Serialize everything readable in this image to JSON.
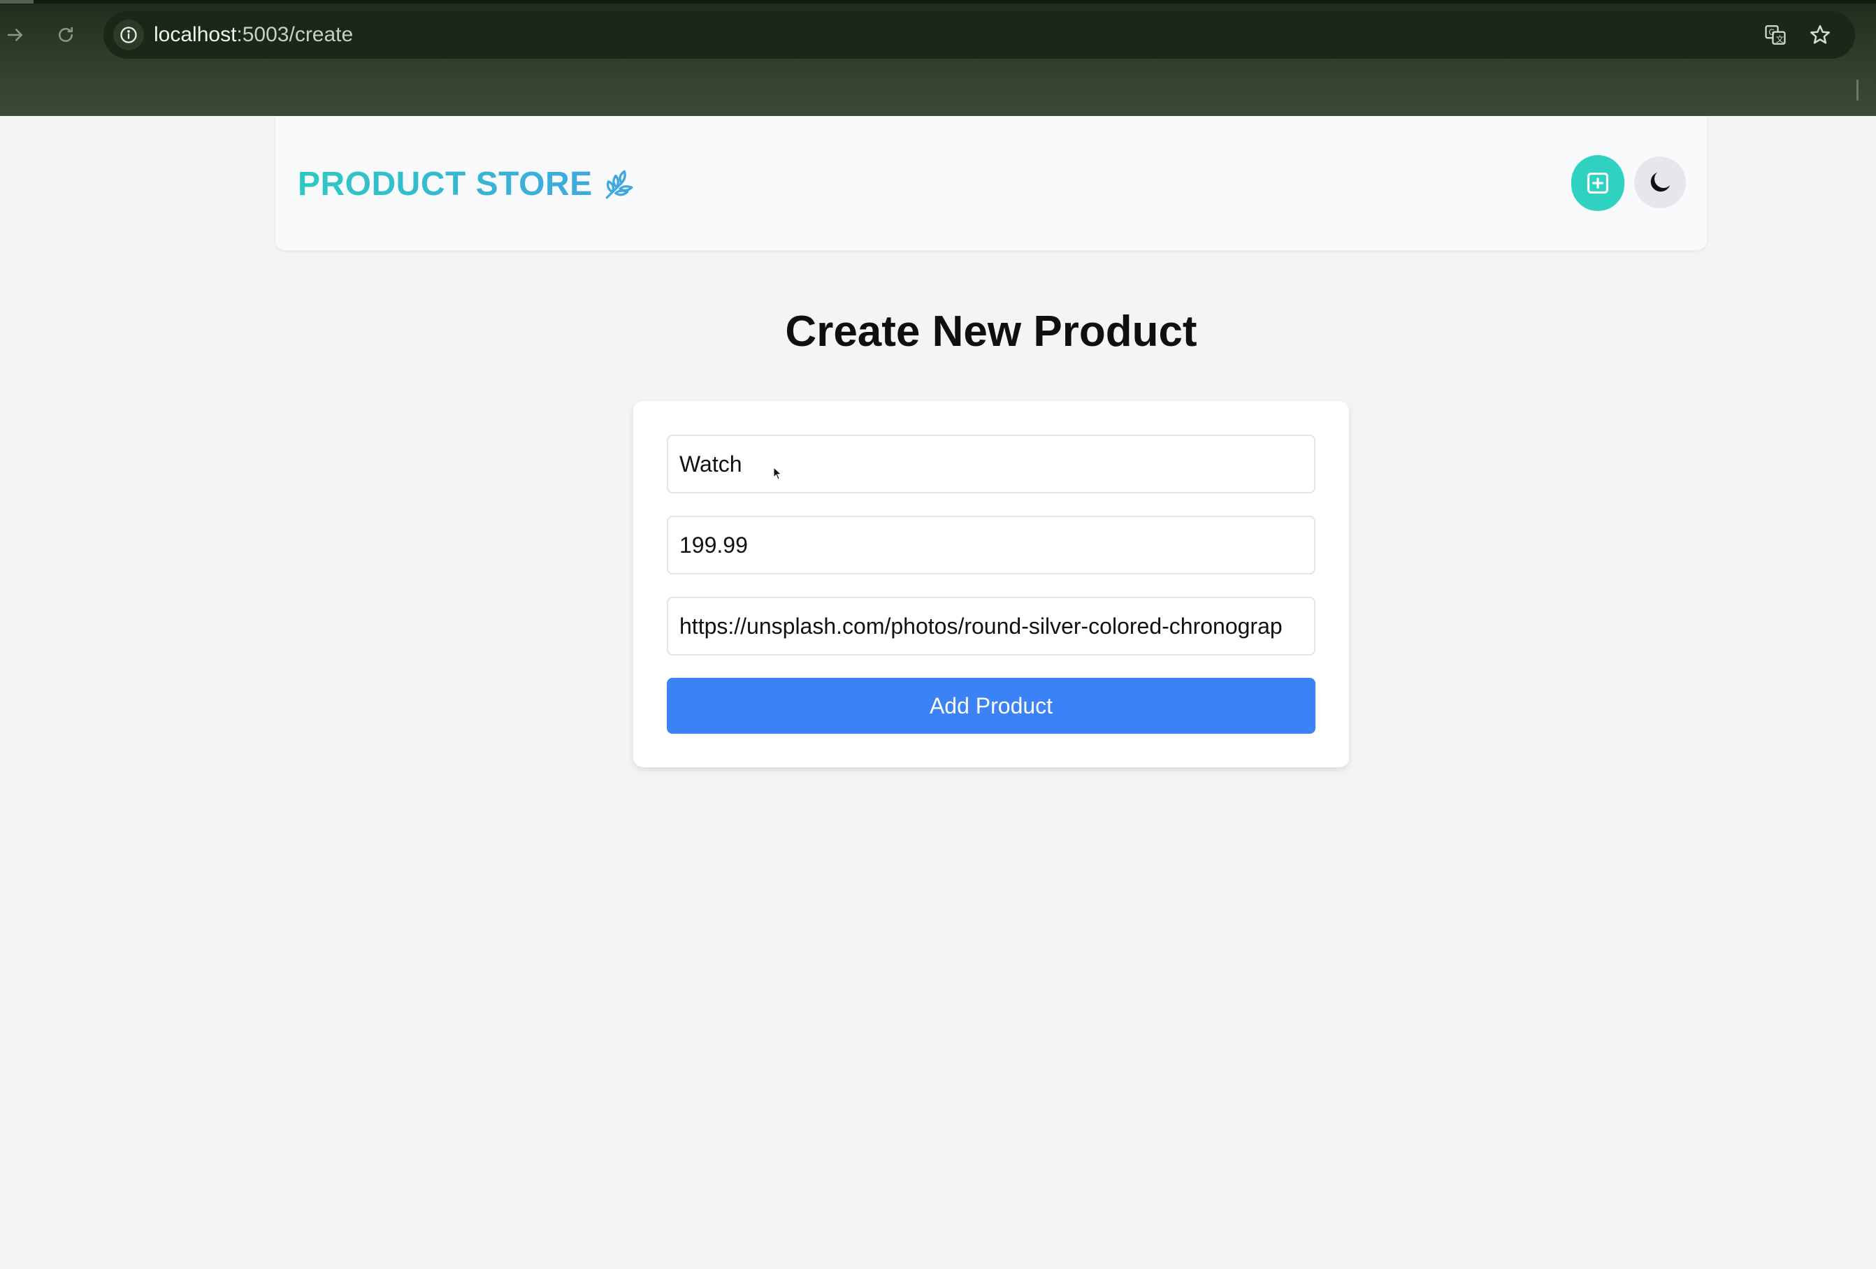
{
  "browser": {
    "url_host": "localhost",
    "url_path": ":5003/create",
    "icons": [
      "forward-icon",
      "reload-icon",
      "info-icon",
      "translate-icon",
      "bookmark-star-icon"
    ]
  },
  "navbar": {
    "brand": "PRODUCT STORE",
    "brand_icon": "leaf-icon",
    "create_icon": "plus-square-icon",
    "theme_icon": "moon-icon",
    "accent": "#2fd1c0"
  },
  "page": {
    "title": "Create New Product"
  },
  "form": {
    "name_value": "Watch",
    "price_value": "199.99",
    "image_value": "https://unsplash.com/photos/round-silver-colored-chronograp",
    "submit_label": "Add Product",
    "submit_color": "#3b82f6"
  }
}
